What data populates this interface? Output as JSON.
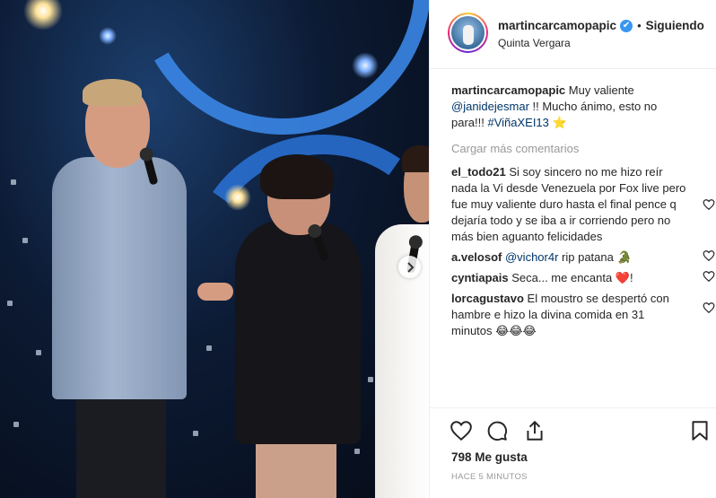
{
  "post": {
    "username": "martincarcamopapic",
    "verified_mark": "✔",
    "separator": "•",
    "follow_status": "Siguiendo",
    "location": "Quinta Vergara",
    "caption": {
      "user": "martincarcamopapic",
      "text_before": " Muy valiente ",
      "mention": "@janidejesmar",
      "text_middle": " !! Mucho ánimo, esto no para!!! ",
      "hashtag": "#ViñaXEI13",
      "emoji": "⭐"
    },
    "load_more": "Cargar más comentarios",
    "comments": [
      {
        "user": "el_todo21",
        "text": "Si soy sincero no me hizo reír nada la Vi desde Venezuela por Fox live pero fue muy valiente duro hasta el final pence q dejaría todo y se iba a ir corriendo pero no más bien aguanto felicidades",
        "mention": "",
        "after": ""
      },
      {
        "user": "a.velosof",
        "text": "",
        "mention": "@vichor4r",
        "after": " rip patana 🐊"
      },
      {
        "user": "cyntiapais",
        "text": "Seca... me encanta ❤️!",
        "mention": "",
        "after": ""
      },
      {
        "user": "lorcagustavo",
        "text": "El moustro se despertó con hambre e hizo la divina comida en 31 minutos 😂😂😂",
        "mention": "",
        "after": ""
      }
    ],
    "likes": "798 Me gusta",
    "time_ago": "HACE 5 MINUTOS"
  },
  "icons": {
    "next": "chevron-right-icon",
    "like": "heart-icon",
    "comment": "comment-icon",
    "share": "share-icon",
    "save": "bookmark-icon"
  },
  "colors": {
    "verified": "#3897f0",
    "mention": "#003569",
    "muted": "#999999",
    "text": "#262626"
  }
}
